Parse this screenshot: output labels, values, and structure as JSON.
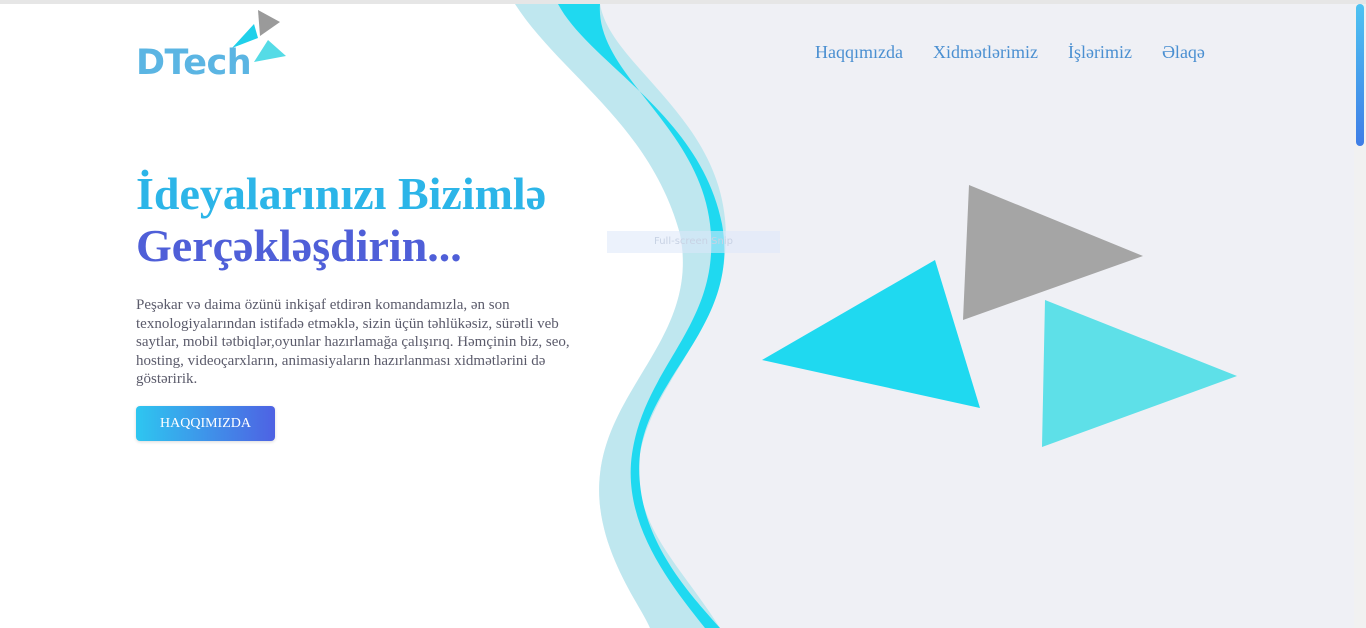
{
  "brand": {
    "logo_text": "DTech",
    "logo_color": "#5bb5e3"
  },
  "nav": {
    "items": [
      {
        "label": "Haqqımızda"
      },
      {
        "label": "Xidmətlərimiz"
      },
      {
        "label": "İşlərimiz"
      },
      {
        "label": "Əlaqə"
      }
    ]
  },
  "hero": {
    "title_line1": "İdeyalarınızı Bizimlə",
    "title_line2": "Gerçəkləşdirin...",
    "description": "Peşəkar və daima özünü inkişaf etdirən komandamızla, ən son texnologiyalarından istifadə etməklə, sizin üçün təhlükəsiz, sürətli veb saytlar, mobil tətbiqlər,oyunlar hazırlamağa çalışırıq. Həmçinin biz, seo, hosting, videoçarxların, animasiyaların hazırlanması xidmətlərini də göstəririk.",
    "cta_label": "HAQQIMIZDA"
  },
  "overlay": {
    "snip_label": "Full-screen Snip"
  },
  "colors": {
    "accent_cyan": "#1fd9f0",
    "light_cyan": "#bfe7ef",
    "panel_bg": "#eff0f5",
    "gray_triangle": "#a5a5a5",
    "teal_triangle": "#5ee0e8",
    "title_blue": "#2cb5e8",
    "title_indigo": "#4f5fd8"
  },
  "icons": {
    "logo_shapes": "triangles-icon",
    "hero_graphic": "triangles-illustration"
  }
}
